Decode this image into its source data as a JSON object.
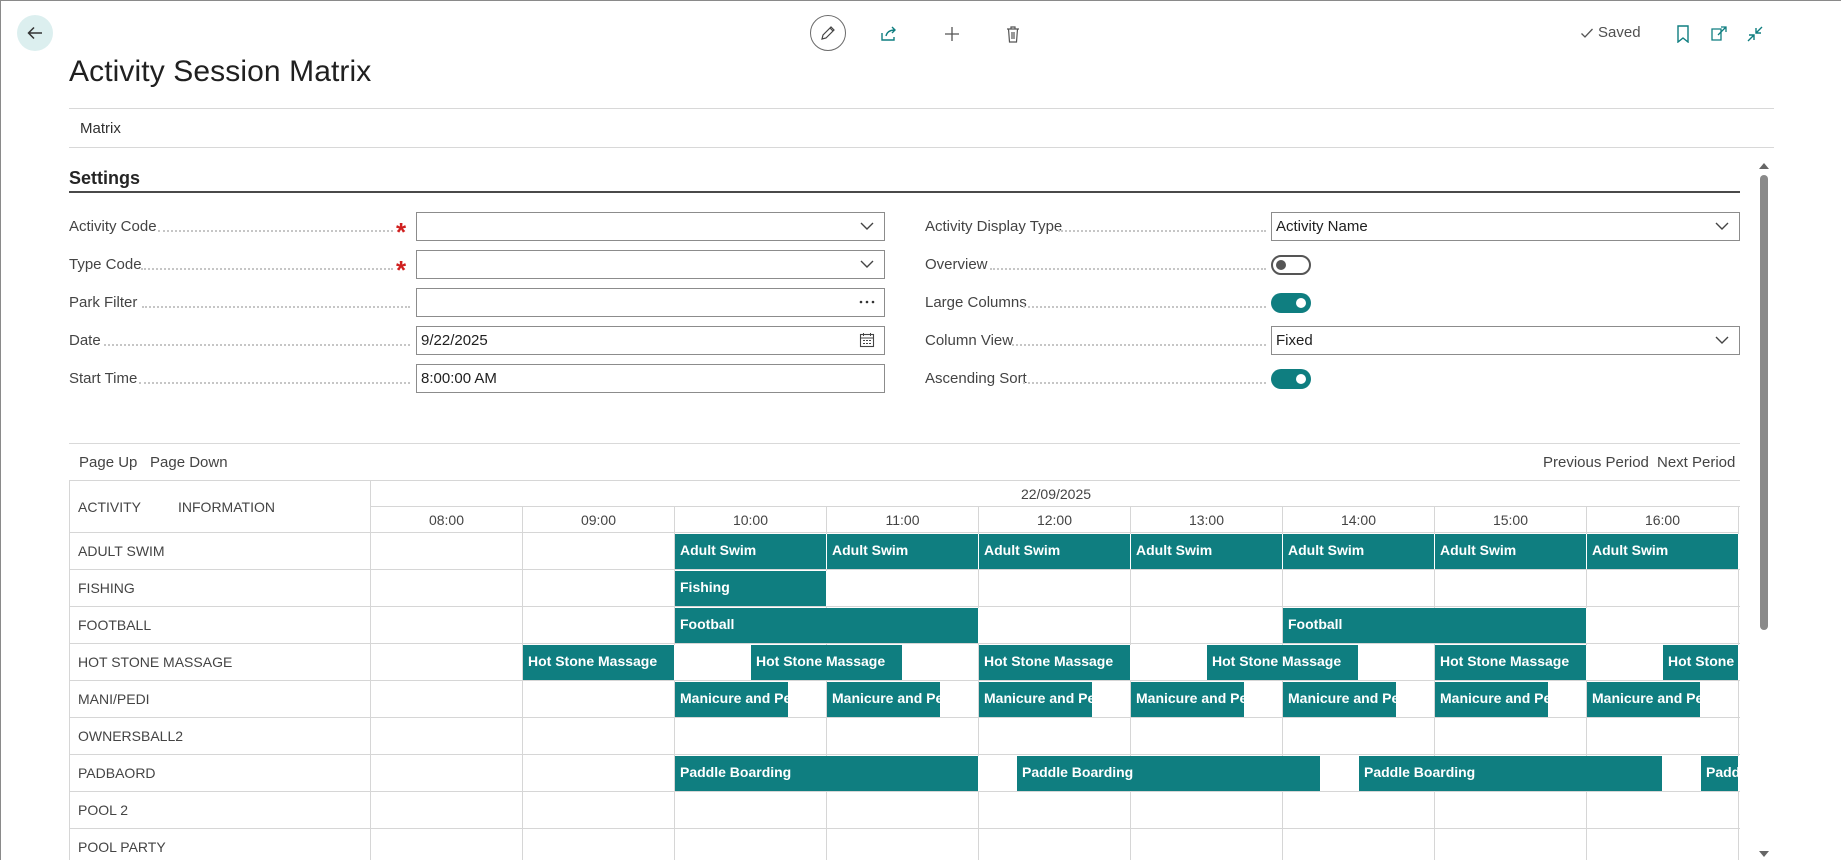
{
  "toolbar": {
    "back_icon": "arrow-left-icon",
    "edit_icon": "pencil-icon",
    "share_icon": "share-icon",
    "add_icon": "plus-icon",
    "delete_icon": "trash-icon",
    "saved_label": "Saved",
    "bookmark_icon": "bookmark-icon",
    "open_new_window_icon": "open-in-new-window-icon",
    "collapse_icon": "collapse-icon"
  },
  "page": {
    "title": "Activity Session Matrix",
    "action_tab": "Matrix"
  },
  "settings": {
    "title": "Settings",
    "left_fields": [
      {
        "label": "Activity Code",
        "value": "",
        "required": true,
        "control": "dropdown"
      },
      {
        "label": "Type Code",
        "value": "",
        "required": true,
        "control": "dropdown"
      },
      {
        "label": "Park Filter",
        "value": "",
        "required": false,
        "control": "lookup"
      },
      {
        "label": "Date",
        "value": "9/22/2025",
        "required": false,
        "control": "date"
      },
      {
        "label": "Start Time",
        "value": "8:00:00 AM",
        "required": false,
        "control": "text"
      }
    ],
    "right_fields": [
      {
        "label": "Activity Display Type",
        "control": "dropdown",
        "value": "Activity Name"
      },
      {
        "label": "Overview",
        "control": "toggle",
        "value": false
      },
      {
        "label": "Large Columns",
        "control": "toggle",
        "value": true
      },
      {
        "label": "Column View",
        "control": "dropdown",
        "value": "Fixed"
      },
      {
        "label": "Ascending Sort",
        "control": "toggle",
        "value": true
      }
    ]
  },
  "matrix_nav": {
    "page_up": "Page Up",
    "page_down": "Page Down",
    "previous_period": "Previous Period",
    "next_period": "Next Period"
  },
  "matrix": {
    "header_activity": "ACTIVITY",
    "header_information": "INFORMATION",
    "date": "22/09/2025",
    "hours": [
      "08:00",
      "09:00",
      "10:00",
      "11:00",
      "12:00",
      "13:00",
      "14:00",
      "15:00",
      "16:00"
    ],
    "accent_color": "#0f7e80",
    "rows": [
      {
        "activity": "ADULT SWIM",
        "sessions": [
          {
            "label": "Adult Swim",
            "start": "10:00",
            "end": "11:00"
          },
          {
            "label": "Adult Swim",
            "start": "11:00",
            "end": "12:00"
          },
          {
            "label": "Adult Swim",
            "start": "12:00",
            "end": "13:00"
          },
          {
            "label": "Adult Swim",
            "start": "13:00",
            "end": "14:00"
          },
          {
            "label": "Adult Swim",
            "start": "14:00",
            "end": "15:00"
          },
          {
            "label": "Adult Swim",
            "start": "15:00",
            "end": "16:00"
          },
          {
            "label": "Adult Swim",
            "start": "16:00",
            "end": "17:00"
          }
        ]
      },
      {
        "activity": "FISHING",
        "sessions": [
          {
            "label": "Fishing",
            "start": "10:00",
            "end": "11:00"
          }
        ]
      },
      {
        "activity": "FOOTBALL",
        "sessions": [
          {
            "label": "Football",
            "start": "10:00",
            "end": "12:00"
          },
          {
            "label": "Football",
            "start": "14:00",
            "end": "16:00"
          }
        ]
      },
      {
        "activity": "HOT STONE MASSAGE",
        "sessions": [
          {
            "label": "Hot Stone Massage",
            "start": "09:00",
            "end": "10:00"
          },
          {
            "label": "Hot Stone Massage",
            "start": "10:30",
            "end": "11:30"
          },
          {
            "label": "Hot Stone Massage",
            "start": "12:00",
            "end": "13:00"
          },
          {
            "label": "Hot Stone Massage",
            "start": "13:30",
            "end": "14:30"
          },
          {
            "label": "Hot Stone Massage",
            "start": "15:00",
            "end": "16:00"
          },
          {
            "label": "Hot Stone Massage",
            "start": "16:30",
            "end": "17:00"
          }
        ]
      },
      {
        "activity": "MANI/PEDI",
        "sessions": [
          {
            "label": "Manicure and Pedicure",
            "start": "10:00",
            "end": "10:45"
          },
          {
            "label": "Manicure and Pedicure",
            "start": "11:00",
            "end": "11:45"
          },
          {
            "label": "Manicure and Pedicure",
            "start": "12:00",
            "end": "12:45"
          },
          {
            "label": "Manicure and Pedicure",
            "start": "13:00",
            "end": "13:45"
          },
          {
            "label": "Manicure and Pedicure",
            "start": "14:00",
            "end": "14:45"
          },
          {
            "label": "Manicure and Pedicure",
            "start": "15:00",
            "end": "15:45"
          },
          {
            "label": "Manicure and Pedicure",
            "start": "16:00",
            "end": "16:45"
          }
        ]
      },
      {
        "activity": "OWNERSBALL2",
        "sessions": []
      },
      {
        "activity": "PADBAORD",
        "sessions": [
          {
            "label": "Paddle Boarding",
            "start": "10:00",
            "end": "12:00"
          },
          {
            "label": "Paddle Boarding",
            "start": "12:15",
            "end": "14:15"
          },
          {
            "label": "Paddle Boarding",
            "start": "14:30",
            "end": "16:30"
          },
          {
            "label": "Paddle Boarding",
            "start": "16:45",
            "end": "17:00"
          }
        ]
      },
      {
        "activity": "POOL 2",
        "sessions": []
      },
      {
        "activity": "POOL PARTY",
        "sessions": []
      }
    ]
  }
}
